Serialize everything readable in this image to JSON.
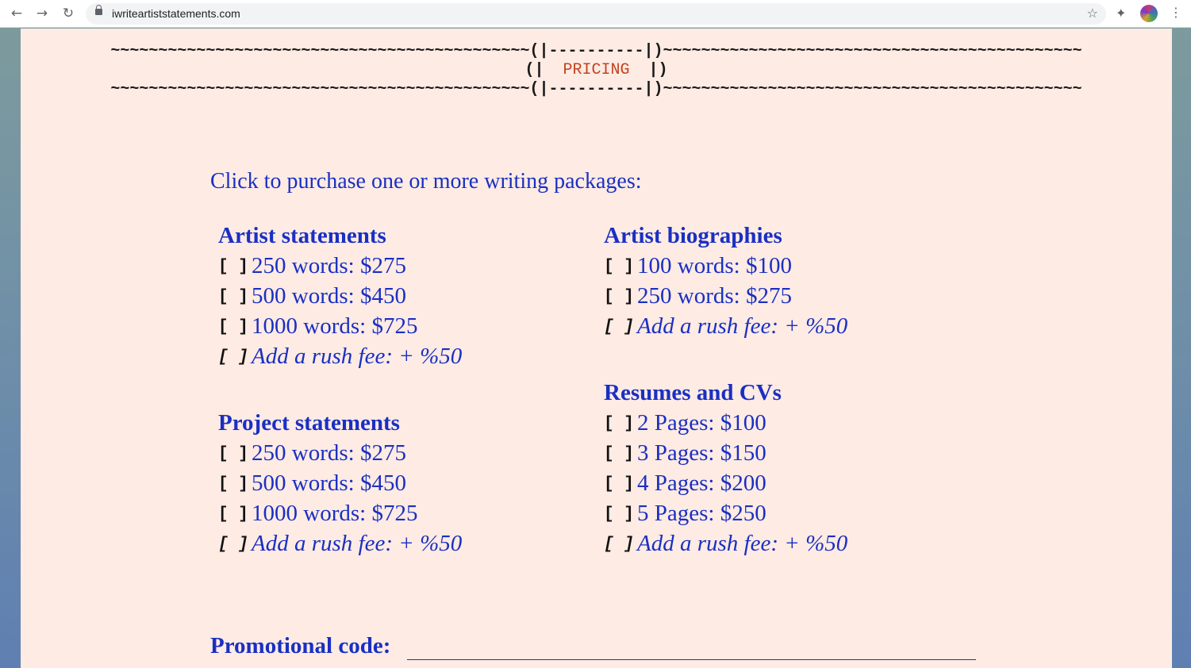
{
  "browser": {
    "url": "iwriteartiststatements.com",
    "back_icon": "←",
    "forward_icon": "→",
    "reload_icon": "↻",
    "star_icon": "☆",
    "extensions_icon": "✦",
    "menu_icon": "⋮"
  },
  "banner": {
    "line1": "~~~~~~~~~~~~~~~~~~~~~~~~~~~~~~~~~~~~~~~~~~~~(|----------|)~~~~~~~~~~~~~~~~~~~~~~~~~~~~~~~~~~~~~~~~~~~~",
    "left": "(|  ",
    "title": "PRICING",
    "right": "  |)",
    "line3": "~~~~~~~~~~~~~~~~~~~~~~~~~~~~~~~~~~~~~~~~~~~~(|----------|)~~~~~~~~~~~~~~~~~~~~~~~~~~~~~~~~~~~~~~~~~~~~"
  },
  "intro": "Click to purchase one or more writing packages:",
  "checkbox": "[ ]",
  "sections": {
    "artist_statements": {
      "title": "Artist statements",
      "options": [
        "250 words: $275",
        "500 words: $450",
        "1000 words: $725",
        "Add a rush fee: + %50"
      ]
    },
    "project_statements": {
      "title": "Project statements",
      "options": [
        "250 words: $275",
        "500 words: $450",
        "1000 words: $725",
        "Add a rush fee: + %50"
      ]
    },
    "artist_biographies": {
      "title": "Artist biographies",
      "options": [
        "100 words: $100",
        "250 words: $275",
        "Add a rush fee: + %50"
      ]
    },
    "resumes": {
      "title": "Resumes and CVs",
      "options": [
        "2 Pages: $100",
        "3 Pages: $150",
        "4 Pages: $200",
        "5 Pages: $250",
        "Add a rush fee: + %50"
      ]
    }
  },
  "promo": {
    "label": "Promotional code:"
  },
  "colors": {
    "link": "#1a2fc2",
    "page_bg": "#fdebe4",
    "accent": "#c2441e"
  }
}
